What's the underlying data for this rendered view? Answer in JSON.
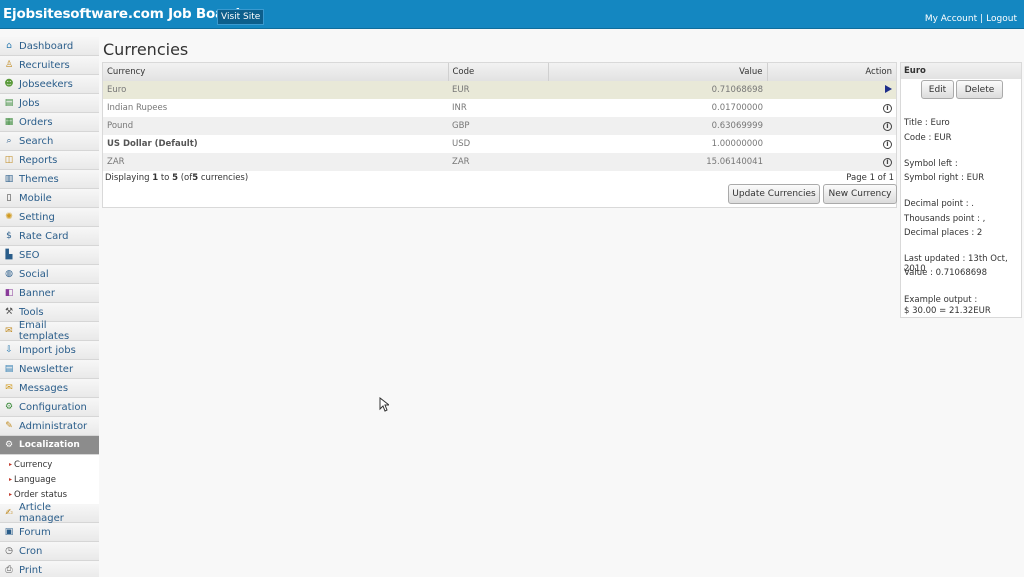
{
  "header": {
    "title": "Ejobsitesoftware.com Job Board",
    "visit_site": "Visit Site",
    "my_account": "My Account",
    "separator": "|",
    "logout": "Logout"
  },
  "sidebar": {
    "items": [
      {
        "label": "Dashboard",
        "icon": "home-icon",
        "glyph": "⌂",
        "color": "#2a7ab0"
      },
      {
        "label": "Recruiters",
        "icon": "recruiter-icon",
        "glyph": "♙",
        "color": "#c08a20"
      },
      {
        "label": "Jobseekers",
        "icon": "jobseekers-icon",
        "glyph": "☻",
        "color": "#5a9a3a"
      },
      {
        "label": "Jobs",
        "icon": "jobs-icon",
        "glyph": "▤",
        "color": "#3a8a3a"
      },
      {
        "label": "Orders",
        "icon": "orders-icon",
        "glyph": "▦",
        "color": "#3a8a3a"
      },
      {
        "label": "Search",
        "icon": "search-icon",
        "glyph": "⌕",
        "color": "#2a5d8a"
      },
      {
        "label": "Reports",
        "icon": "reports-icon",
        "glyph": "◫",
        "color": "#c08a20"
      },
      {
        "label": "Themes",
        "icon": "themes-icon",
        "glyph": "▥",
        "color": "#2a5d8a"
      },
      {
        "label": "Mobile",
        "icon": "mobile-icon",
        "glyph": "▯",
        "color": "#333"
      },
      {
        "label": "Setting",
        "icon": "setting-icon",
        "glyph": "✺",
        "color": "#d09a20"
      },
      {
        "label": "Rate Card",
        "icon": "dollar-icon",
        "glyph": "$",
        "color": "#2a5d8a"
      },
      {
        "label": "SEO",
        "icon": "seo-icon",
        "glyph": "▙",
        "color": "#2a5d8a"
      },
      {
        "label": "Social",
        "icon": "globe-icon",
        "glyph": "◍",
        "color": "#2a5d8a"
      },
      {
        "label": "Banner",
        "icon": "banner-icon",
        "glyph": "◧",
        "color": "#8a3a9a"
      },
      {
        "label": "Tools",
        "icon": "tools-icon",
        "glyph": "⚒",
        "color": "#555"
      },
      {
        "label": "Email templates",
        "icon": "email-icon",
        "glyph": "✉",
        "color": "#c08a20"
      },
      {
        "label": "Import jobs",
        "icon": "import-icon",
        "glyph": "⇩",
        "color": "#2a7ab0"
      },
      {
        "label": "Newsletter",
        "icon": "newsletter-icon",
        "glyph": "▤",
        "color": "#2a7ab0"
      },
      {
        "label": "Messages",
        "icon": "messages-icon",
        "glyph": "✉",
        "color": "#d09a20"
      },
      {
        "label": "Configuration",
        "icon": "configuration-icon",
        "glyph": "⚙",
        "color": "#3a8a3a"
      },
      {
        "label": "Administrator",
        "icon": "administrator-icon",
        "glyph": "✎",
        "color": "#c08a20"
      }
    ],
    "active": {
      "label": "Localization",
      "icon": "localization-icon",
      "glyph": "⚙"
    },
    "subitems": [
      "Currency",
      "Language",
      "Order status"
    ],
    "bottom_items": [
      {
        "label": "Article manager",
        "icon": "article-icon",
        "glyph": "✍",
        "color": "#c08a20"
      },
      {
        "label": "Forum",
        "icon": "forum-icon",
        "glyph": "▣",
        "color": "#2a5d8a"
      },
      {
        "label": "Cron",
        "icon": "clock-icon",
        "glyph": "◷",
        "color": "#555"
      },
      {
        "label": "Print",
        "icon": "print-icon",
        "glyph": "⎙",
        "color": "#555"
      }
    ]
  },
  "main": {
    "heading": "Currencies",
    "columns": [
      "Currency",
      "Code",
      "Value",
      "Action"
    ],
    "rows": [
      {
        "currency": "Euro",
        "code": "EUR",
        "value": "0.71068698",
        "action": "play-icon"
      },
      {
        "currency": "Indian Rupees",
        "code": "INR",
        "value": "0.01700000",
        "action": "info-icon"
      },
      {
        "currency": "Pound",
        "code": "GBP",
        "value": "0.63069999",
        "action": "info-icon"
      },
      {
        "currency": "US Dollar (Default)",
        "code": "USD",
        "value": "1.00000000",
        "action": "info-icon"
      },
      {
        "currency": "ZAR",
        "code": "ZAR",
        "value": "15.06140041",
        "action": "info-icon"
      }
    ],
    "displaying": {
      "prefix": "Displaying",
      "from": "1",
      "to_word": "to",
      "to": "5",
      "of_prefix": "(of",
      "total": "5",
      "suffix": "currencies)"
    },
    "page_info": "Page 1 of 1",
    "update_button": "Update Currencies",
    "new_button": "New Currency"
  },
  "detail": {
    "title": "Euro",
    "edit": "Edit",
    "delete": "Delete",
    "lines": [
      "Title : Euro",
      "Code : EUR",
      "Symbol left :",
      "Symbol right : EUR",
      "Decimal point : .",
      "Thousands point : ,",
      "Decimal places : 2",
      "Last updated : 13th Oct, 2010",
      "Value : 0.71068698",
      "Example output :",
      "$ 30.00 = 21.32EUR"
    ]
  }
}
